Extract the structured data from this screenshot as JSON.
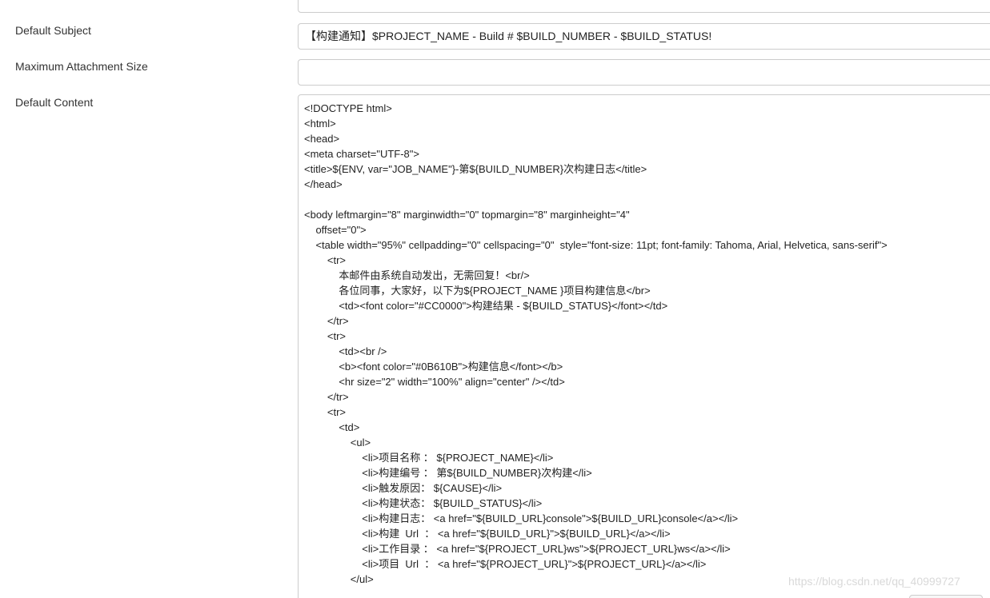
{
  "form": {
    "top_field_value": "",
    "subject_label": "Default Subject",
    "subject_value": "【构建通知】$PROJECT_NAME - Build # $BUILD_NUMBER - $BUILD_STATUS!",
    "attachment_label": "Maximum Attachment Size",
    "attachment_value": "",
    "content_label": "Default Content",
    "content_lines": [
      "<!DOCTYPE html>",
      "<html>",
      "<head>",
      "<meta charset=\"UTF-8\">",
      "<title>${ENV, var=\"JOB_NAME\"}-第${BUILD_NUMBER}次构建日志</title>",
      "</head>",
      "",
      "<body leftmargin=\"8\" marginwidth=\"0\" topmargin=\"8\" marginheight=\"4\"",
      "    offset=\"0\">",
      "    <table width=\"95%\" cellpadding=\"0\" cellspacing=\"0\"  style=\"font-size: 11pt; font-family: Tahoma, Arial, Helvetica, sans-serif\">",
      "        <tr>",
      "            本邮件由系统自动发出，无需回复！<br/>",
      "            各位同事，大家好，以下为${PROJECT_NAME }项目构建信息</br>",
      "            <td><font color=\"#CC0000\">构建结果 - ${BUILD_STATUS}</font></td>",
      "        </tr>",
      "        <tr>",
      "            <td><br />",
      "            <b><font color=\"#0B610B\">构建信息</font></b>",
      "            <hr size=\"2\" width=\"100%\" align=\"center\" /></td>",
      "        </tr>",
      "        <tr>",
      "            <td>",
      "                <ul>",
      "                    <li>项目名称 ： ${PROJECT_NAME}</li>",
      "                    <li>构建编号 ： 第${BUILD_NUMBER}次构建</li>",
      "                    <li>触发原因： ${CAUSE}</li>",
      "                    <li>构建状态： ${BUILD_STATUS}</li>",
      "                    <li>构建日志： <a href=\"${BUILD_URL}console\">${BUILD_URL}console</a></li>",
      "                    <li>构建  Url  ： <a href=\"${BUILD_URL}\">${BUILD_URL}</a></li>",
      "                    <li>工作目录 ： <a href=\"${PROJECT_URL}ws\">${PROJECT_URL}ws</a></li>",
      "                    <li>项目  Url  ： <a href=\"${PROJECT_URL}\">${PROJECT_URL}</a></li>",
      "                </ul>"
    ]
  },
  "watermark": "https://blog.csdn.net/qq_40999727"
}
